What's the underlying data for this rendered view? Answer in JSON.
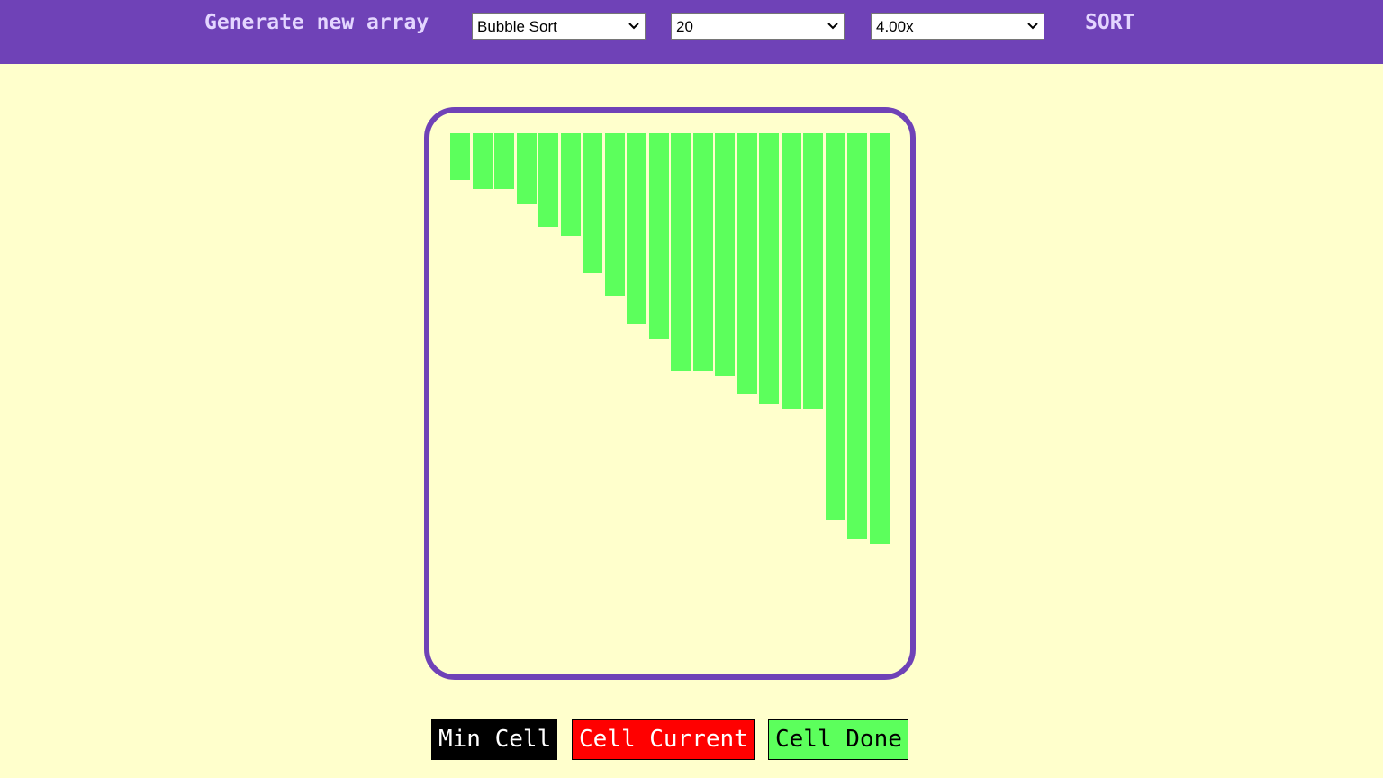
{
  "toolbar": {
    "generate_label": "Generate new array",
    "sort_label": "SORT",
    "algorithm": "Bubble Sort",
    "array_size": "20",
    "speed": "4.00x"
  },
  "array": {
    "bar_color": "#5cff5c",
    "values": [
      52,
      62,
      62,
      78,
      104,
      114,
      155,
      181,
      212,
      228,
      264,
      264,
      270,
      290,
      301,
      306,
      306,
      430,
      451,
      456
    ]
  },
  "legend": {
    "min_cell": "Min Cell",
    "cell_current": "Cell Current",
    "cell_done": "Cell Done"
  },
  "colors": {
    "accent": "#6f42b7",
    "background": "#ffffcc",
    "min_cell": "#000000",
    "cell_current": "#ff0000",
    "cell_done": "#5cff5c"
  }
}
